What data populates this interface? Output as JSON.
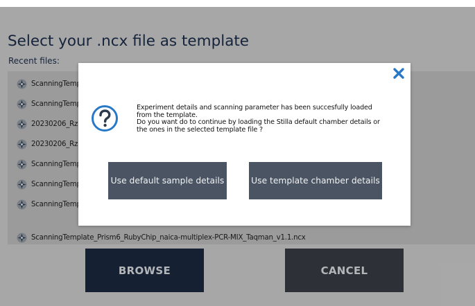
{
  "window": {
    "title": "Select your .ncx file as template",
    "recent_label": "Recent files:"
  },
  "recent_files": [
    "ScanningTemplate",
    "ScanningTemplate",
    "20230206_Rz",
    "20230206_Rz",
    "ScanningTemplate",
    "ScanningTemplate",
    "ScanningTemplate",
    "ScanningTemplate_Prism6_RubyChip_naica-multiplex-PCR-MIX_Taqman_v1.1.ncx"
  ],
  "buttons": {
    "browse": "BROWSE",
    "cancel": "CANCEL"
  },
  "dialog": {
    "line1": "Experiment details and scanning parameter has been succesfully loaded",
    "line2": "from the template.",
    "line3": "Do you want do to continue by  loading the Stilla default chamber details or",
    "line4": "the ones in the selected template file ?",
    "default_button": "Use default sample details",
    "template_button": "Use template chamber details"
  },
  "icons": {
    "file": "template-file-icon",
    "close": "close-icon",
    "question": "question-icon"
  },
  "colors": {
    "accent_blue": "#2878c8",
    "title_navy": "#1b2e4c",
    "browse_bg": "#1c2a42",
    "cancel_bg": "#3a3f47",
    "dialog_button_bg": "#4a5462"
  }
}
